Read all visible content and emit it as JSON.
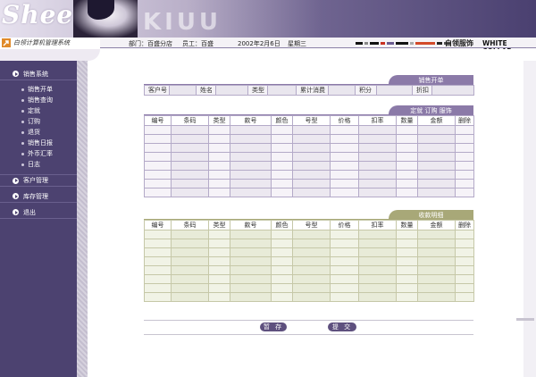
{
  "header": {
    "logo": "Shee's",
    "ghost": "KIUU"
  },
  "infobar": {
    "system_name": "白领计算机管理系统",
    "store": "部门：百盛分店",
    "staff": "员工：百盛",
    "date": "2002年2月6日",
    "weekday": "星期三",
    "brand_cn": "白领服饰",
    "brand_en": "WHITE COLLAR"
  },
  "sidebar": {
    "groups": [
      {
        "label": "销售系统"
      },
      {
        "label": "客户管理"
      },
      {
        "label": "库存管理"
      },
      {
        "label": "退出"
      }
    ],
    "sub_items": [
      "销售开单",
      "销售查询",
      "定就",
      "订购",
      "退货",
      "销售日报",
      "外币汇率",
      "日志"
    ]
  },
  "sale_tab": "销售开单",
  "customer_row": [
    "客户号",
    "",
    "姓名",
    "",
    "类型",
    "",
    "累计消费",
    "",
    "积分",
    "",
    "折扣",
    ""
  ],
  "order_tab": "定就  订购  服饰",
  "columns": [
    "编号",
    "条码",
    "类型",
    "款号",
    "颜色",
    "号型",
    "价格",
    "扣率",
    "数量",
    "金额",
    "删除"
  ],
  "receipt_tab": "收款明细",
  "buttons": {
    "save": "暂 存",
    "submit": "提 交"
  },
  "colors": {
    "sidebar": "#4c4270",
    "tab_purple": "#8b7aa8",
    "tab_olive": "#a8a878"
  }
}
